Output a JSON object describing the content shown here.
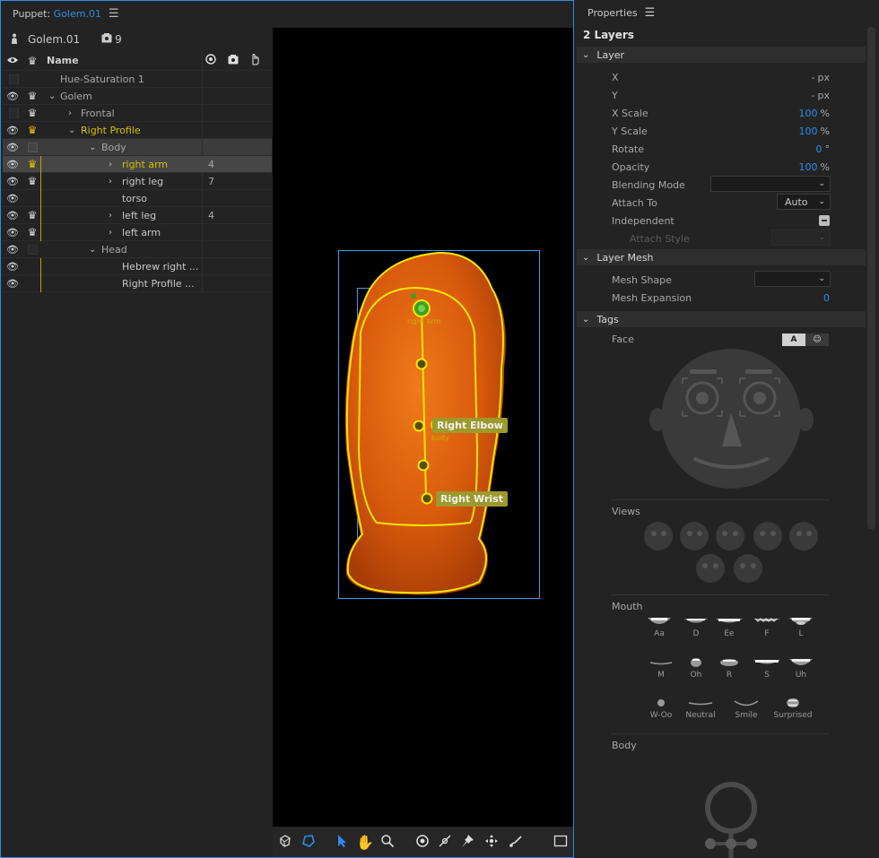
{
  "puppet_panel": {
    "tab_prefix": "Puppet:",
    "tab_name": "Golem.01",
    "menu_icon": "hamburger-menu-icon",
    "puppet_name": "Golem.01",
    "puppet_count": "9",
    "header": {
      "name_label": "Name"
    },
    "rows": [
      {
        "name": "Hue-Saturation 1",
        "count": ""
      },
      {
        "name": "Golem",
        "count": ""
      },
      {
        "name": "Frontal",
        "count": ""
      },
      {
        "name": "Right Profile",
        "count": ""
      },
      {
        "name": "Body",
        "count": ""
      },
      {
        "name": "right arm",
        "count": "4"
      },
      {
        "name": "right leg",
        "count": "7"
      },
      {
        "name": "torso",
        "count": ""
      },
      {
        "name": "left leg",
        "count": "4"
      },
      {
        "name": "left arm",
        "count": ""
      },
      {
        "name": "Head",
        "count": ""
      },
      {
        "name": "Hebrew right ...",
        "count": ""
      },
      {
        "name": "Right Profile ...",
        "count": ""
      }
    ],
    "canvas": {
      "handle_labels": {
        "top": "right arm",
        "elbow": "Right Elbow",
        "body": "body",
        "wrist": "Right Wrist"
      }
    },
    "tools": [
      "warp-icon",
      "lasso-icon",
      "select-arrow-icon",
      "hand-icon",
      "zoom-icon",
      "origin-icon",
      "pen-icon",
      "pin-icon",
      "move-icon",
      "brush-icon",
      "square-icon"
    ]
  },
  "properties": {
    "tab_label": "Properties",
    "layers_count": "2 Layers",
    "layer_section": "Layer",
    "x": {
      "label": "X",
      "value": "-",
      "unit": "px"
    },
    "y": {
      "label": "Y",
      "value": "-",
      "unit": "px"
    },
    "x_scale": {
      "label": "X Scale",
      "value": "100",
      "unit": "%"
    },
    "y_scale": {
      "label": "Y Scale",
      "value": "100",
      "unit": "%"
    },
    "rotate": {
      "label": "Rotate",
      "value": "0",
      "unit": "°"
    },
    "opacity": {
      "label": "Opacity",
      "value": "100",
      "unit": "%"
    },
    "blending_mode": {
      "label": "Blending Mode",
      "value": ""
    },
    "attach_to": {
      "label": "Attach To",
      "value": "Auto"
    },
    "independent": {
      "label": "Independent"
    },
    "attach_style": {
      "label": "Attach Style"
    },
    "mesh_section": "Layer Mesh",
    "mesh_shape": {
      "label": "Mesh Shape",
      "value": ""
    },
    "mesh_expansion": {
      "label": "Mesh Expansion",
      "value": "0"
    },
    "tags_section": "Tags",
    "face_label": "Face",
    "face_toggle": {
      "text": "A",
      "face": "☺"
    },
    "views_label": "Views",
    "mouth_label": "Mouth",
    "mouth_shapes": [
      "Aa",
      "D",
      "Ee",
      "F",
      "L",
      "M",
      "Oh",
      "R",
      "S",
      "Uh",
      "W-Oo",
      "Neutral",
      "Smile",
      "Surprised"
    ],
    "body_label": "Body"
  },
  "colors": {
    "accent": "#2d8ceb",
    "handle": "#e8c400",
    "selection_text": "#d4c000",
    "mesh_fill": "#e86a10"
  }
}
